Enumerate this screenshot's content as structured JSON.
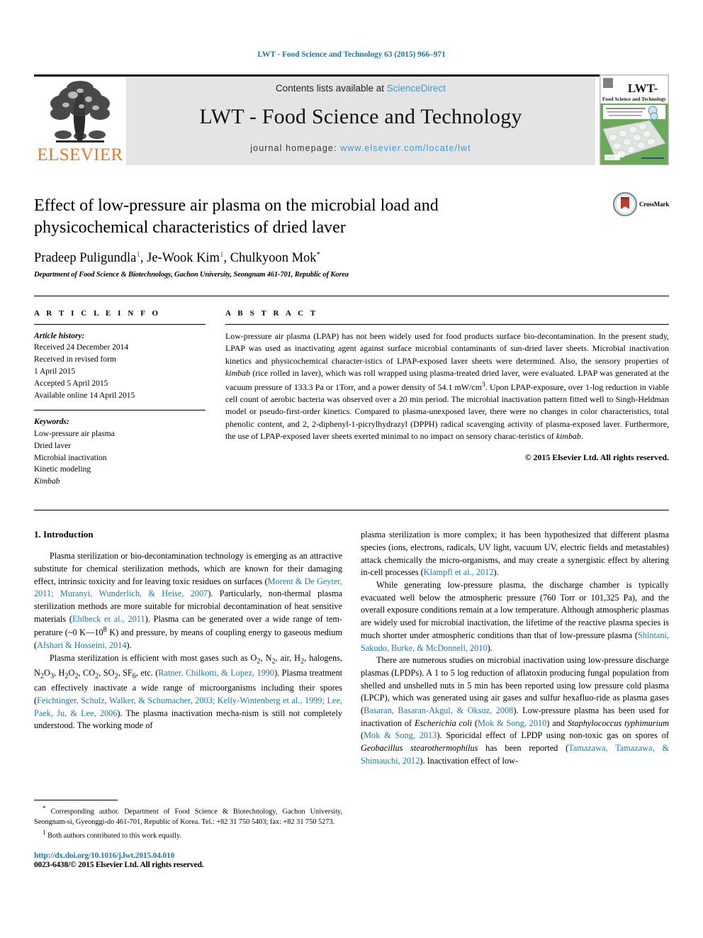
{
  "running_head": "LWT - Food Science and Technology 63 (2015) 966–971",
  "masthead": {
    "contents_prefix": "Contents lists available at ",
    "sciencedirect": "ScienceDirect",
    "journal_title": "LWT - Food Science and Technology",
    "homepage_prefix": "journal homepage: ",
    "homepage_url": "www.elsevier.com/locate/lwt",
    "publisher_name": "ELSEVIER",
    "cover_title": "LWT-",
    "cover_subtitle": "Food Science and Technology",
    "link_color": "#3d9ad1",
    "band_color": "#e4e4e4",
    "publisher_color": "#E87722"
  },
  "article": {
    "title": "Effect of low-pressure air plasma on the microbial load and physicochemical characteristics of dried laver",
    "authors_plain": "Pradeep Puligundla 1, Je-Wook Kim 1, Chulkyoon Mok*",
    "author_1": "Pradeep Puligundla",
    "author_1_sup": "1",
    "author_2": "Je-Wook Kim",
    "author_2_sup": "1",
    "author_3": "Chulkyoon Mok",
    "author_3_sup": "*",
    "affiliation": "Department of Food Science & Biotechnology, Gachon University, Seongnam 461-701, Republic of Korea",
    "crossmark_label": "CrossMark"
  },
  "article_info": {
    "heading": "A R T I C L E   I N F O",
    "history_label": "Article history:",
    "history_lines": [
      "Received 24 December 2014",
      "Received in revised form",
      "1 April 2015",
      "Accepted 5 April 2015",
      "Available online 14 April 2015"
    ],
    "keywords_label": "Keywords:",
    "keywords": [
      "Low-pressure air plasma",
      "Dried laver",
      "Microbial inactivation",
      "Kinetic modeling",
      "Kimbab"
    ],
    "keywords_italic_index": 4
  },
  "abstract": {
    "heading": "A B S T R A C T",
    "paragraph_parts": [
      {
        "t": "Low-pressure air plasma (LPAP) has not been widely used for food products surface bio-decontamination. In the present study, LPAP was used as inactivating agent against surface microbial contaminants of sun-dried laver sheets. Microbial inactivation kinetics and physicochemical character-istics of LPAP-exposed laver sheets were determined. Also, the sensory properties of "
      },
      {
        "t": "kimbab",
        "i": true
      },
      {
        "t": " (rice rolled in laver), which was roll wrapped using plasma-treated dried laver, were evaluated. LPAP was generated at the vacuum pressure of 133.3 Pa or 1Torr, and a power density of 54.1 mW/cm"
      },
      {
        "t": "3",
        "sup": true
      },
      {
        "t": ". Upon LPAP-exposure, over 1-log reduction in viable cell count of aerobic bacteria was observed over a 20 min period. The microbial inactivation pattern fitted well to Singh-Heldman model or pseudo-first-order kinetics. Compared to plasma-unexposed laver, there were no changes in color characteristics, total phenolic content, and 2, 2-diphenyl-1-picrylhydrazyl (DPPH) radical scavenging activity of plasma-exposed laver. Furthermore, the use of LPAP-exposed laver sheets exerted minimal to no impact on sensory charac-teristics of "
      },
      {
        "t": "kimbab",
        "i": true
      },
      {
        "t": "."
      }
    ],
    "copyright": "© 2015 Elsevier Ltd. All rights reserved."
  },
  "intro": {
    "section_title": "1.  Introduction",
    "left_paragraphs": [
      [
        {
          "t": "Plasma sterilization or bio-decontamination technology is emerging as an attractive substitute for chemical sterilization methods, which are known for their damaging effect, intrinsic toxicity and for leaving toxic residues on surfaces ("
        },
        {
          "t": "Morent & De Geyter, 2011; Muranyi, Wunderlich, & Heise, 2007",
          "ref": true
        },
        {
          "t": "). Particularly, non-thermal plasma sterilization methods are more suitable for microbial decontamination of heat sensitive materials ("
        },
        {
          "t": "Ehlbeck et al., 2011",
          "ref": true
        },
        {
          "t": "). Plasma can be generated over a wide range of tem-perature (~0 K—10"
        },
        {
          "t": "8",
          "sup": true
        },
        {
          "t": " K) and pressure, by means of coupling energy to gaseous medium ("
        },
        {
          "t": "Afshari & Hosseini, 2014",
          "ref": true
        },
        {
          "t": ")."
        }
      ],
      [
        {
          "t": "Plasma sterilization is efficient with most gases such as O"
        },
        {
          "t": "2",
          "sub": true
        },
        {
          "t": ", N"
        },
        {
          "t": "2",
          "sub": true
        },
        {
          "t": ", air, H"
        },
        {
          "t": "2",
          "sub": true
        },
        {
          "t": ", halogens, N"
        },
        {
          "t": "2",
          "sub": true
        },
        {
          "t": "O"
        },
        {
          "t": "3",
          "sub": true
        },
        {
          "t": ", H"
        },
        {
          "t": "2",
          "sub": true
        },
        {
          "t": "O"
        },
        {
          "t": "2",
          "sub": true
        },
        {
          "t": ", CO"
        },
        {
          "t": "2",
          "sub": true
        },
        {
          "t": ", SO"
        },
        {
          "t": "2",
          "sub": true
        },
        {
          "t": ", SF"
        },
        {
          "t": "6",
          "sub": true
        },
        {
          "t": ", etc. ("
        },
        {
          "t": "Ratner, Chilkotti, & Lopez, 1990",
          "ref": true
        },
        {
          "t": "). Plasma treatment can effectively inactivate a wide range of microorganisms including their spores ("
        },
        {
          "t": "Feichtinger, Schulz, Walker, & Schumacher, 2003; Kelly-Wintenberg et al., 1999; Lee, Paek, Ju, & Lee, 2006",
          "ref": true
        },
        {
          "t": "). The plasma inactivation mecha-nism is still not completely understood. The working mode of"
        }
      ]
    ],
    "right_paragraphs": [
      [
        {
          "t": "plasma sterilization is more complex; it has been hypothesized that different plasma species (ions, electrons, radicals, UV light, vacuum UV, electric fields and metastables) attack chemically the micro-organisms, and may create a synergistic effect by altering in-cell processes ("
        },
        {
          "t": "Klampfl et al., 2012",
          "ref": true
        },
        {
          "t": ")."
        }
      ],
      [
        {
          "t": "While generating low-pressure plasma, the discharge chamber is typically evacuated well below the atmospheric pressure (760 Torr or 101,325 Pa), and the overall exposure conditions remain at a low temperature. Although atmospheric plasmas are widely used for microbial inactivation, the lifetime of the reactive plasma species is much shorter under atmospheric conditions than that of low-pressure plasma ("
        },
        {
          "t": "Shintani, Sakudo, Burke, & McDonnell, 2010",
          "ref": true
        },
        {
          "t": ")."
        }
      ],
      [
        {
          "t": "There are numerous studies on microbial inactivation using low-pressure discharge plasmas (LPDPs). A 1 to 5 log reduction of aflatoxin producing fungal population from shelled and unshelled nuts in 5 min has been reported using low pressure cold plasma (LPCP), which was generated using air gases and sulfur hexafluo-ride as plasma gases ("
        },
        {
          "t": "Basaran, Basaran-Akgul, & Oksuz, 2008",
          "ref": true
        },
        {
          "t": "). Low-pressure plasma has been used for inactivation of "
        },
        {
          "t": "Escherichia coli",
          "i": true
        },
        {
          "t": " ("
        },
        {
          "t": "Mok & Song, 2010",
          "ref": true
        },
        {
          "t": ") and "
        },
        {
          "t": "Staphylococcus typhimurium",
          "i": true
        },
        {
          "t": " ("
        },
        {
          "t": "Mok & Song, 2013",
          "ref": true
        },
        {
          "t": "). Sporicidal effect of LPDP using non-toxic gas on spores of "
        },
        {
          "t": "Geobacillus stearothermophilus",
          "i": true
        },
        {
          "t": " has been reported ("
        },
        {
          "t": "Tamazawa, Tamazawa, & Shimauchi, 2012",
          "ref": true
        },
        {
          "t": "). Inactivation effect of low-"
        }
      ]
    ]
  },
  "footnotes": {
    "corresponding": {
      "marker": "*",
      "text": " Corresponding author. Department of Food Science & Biotechnology, Gachon University, Seongnam-si, Gyeonggi-do 461-701, Republic of Korea. Tel.: +82 31 750 5403; fax: +82 31 750 5273."
    },
    "equal_contrib": {
      "marker": "1",
      "text": " Both authors contributed to this work equally."
    },
    "doi_url": "http://dx.doi.org/10.1016/j.lwt.2015.04.010",
    "issn_line": "0023-6438/© 2015 Elsevier Ltd. All rights reserved."
  },
  "colors": {
    "link_blue": "#1a7aa8",
    "sciencedirect_blue": "#3d9ad1",
    "elsevier_orange": "#E87722",
    "cover_green": "#5a9e4e"
  }
}
